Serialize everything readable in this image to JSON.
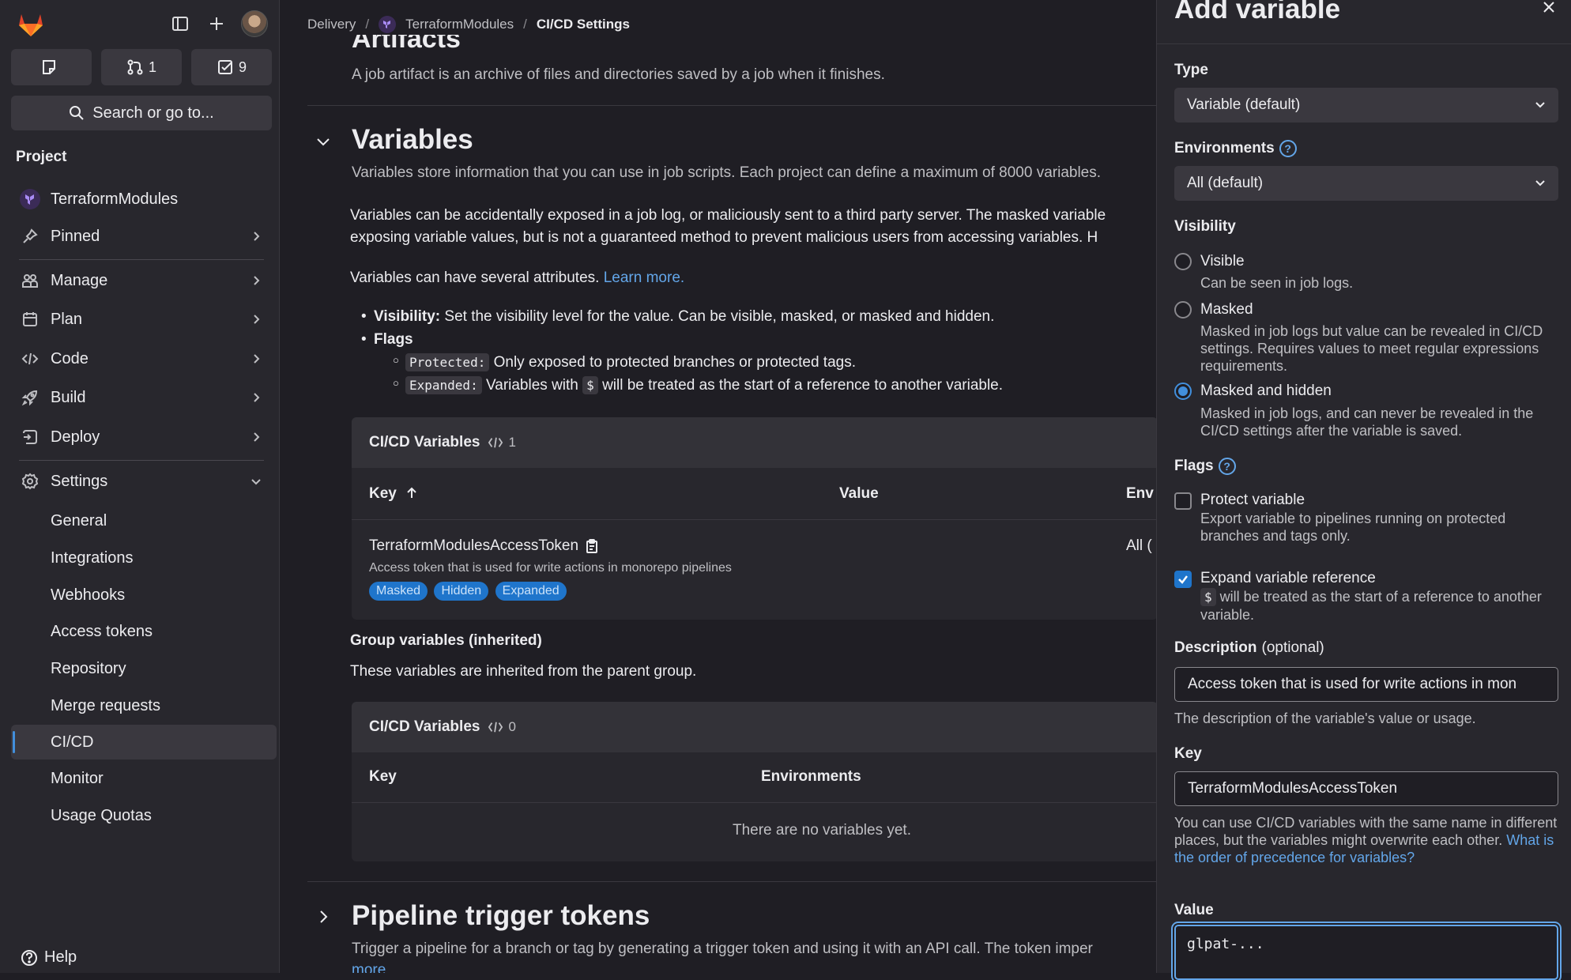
{
  "sidebar": {
    "counters": [
      {
        "icon": "issues-icon",
        "count": ""
      },
      {
        "icon": "merge-request-icon",
        "count": "1"
      },
      {
        "icon": "todo-icon",
        "count": "9"
      }
    ],
    "search_label": "Search or go to...",
    "heading": "Project",
    "project_name": "TerraformModules",
    "nav": {
      "pinned": "Pinned",
      "manage": "Manage",
      "plan": "Plan",
      "code": "Code",
      "build": "Build",
      "deploy": "Deploy",
      "settings": "Settings"
    },
    "settings_items": [
      "General",
      "Integrations",
      "Webhooks",
      "Access tokens",
      "Repository",
      "Merge requests",
      "CI/CD",
      "Monitor",
      "Usage Quotas"
    ],
    "help": "Help"
  },
  "breadcrumb": {
    "group": "Delivery",
    "project": "TerraformModules",
    "current": "CI/CD Settings"
  },
  "artifacts": {
    "title_partial": "Artifacts",
    "description": "A job artifact is an archive of files and directories saved by a job when it finishes."
  },
  "variables": {
    "title": "Variables",
    "intro": "Variables store information that you can use in job scripts. Each project can define a maximum of 8000 variables.",
    "warning_line1": "Variables can be accidentally exposed in a job log, or maliciously sent to a third party server. The masked variable",
    "warning_line2": "exposing variable values, but is not a guaranteed method to prevent malicious users from accessing variables. H",
    "attributes_text": "Variables can have several attributes.",
    "learn_more": "Learn more.",
    "bullet_visibility_bold": "Visibility:",
    "bullet_visibility_text": "Set the visibility level for the value. Can be visible, masked, or masked and hidden.",
    "bullet_flags": "Flags",
    "flag_protected_code": "Protected:",
    "flag_protected_text": "Only exposed to protected branches or protected tags.",
    "flag_expanded_code": "Expanded:",
    "flag_expanded_text_a": "Variables with",
    "flag_expanded_dollar": "$",
    "flag_expanded_text_b": "will be treated as the start of a reference to another variable."
  },
  "project_table": {
    "title": "CI/CD Variables",
    "count": "1",
    "col_key": "Key",
    "col_value": "Value",
    "col_env": "Env",
    "row": {
      "key": "TerraformModulesAccessToken",
      "description": "Access token that is used for write actions in monorepo pipelines",
      "env": "All (",
      "badges": [
        "Masked",
        "Hidden",
        "Expanded"
      ]
    }
  },
  "group_vars": {
    "title": "Group variables (inherited)",
    "description": "These variables are inherited from the parent group."
  },
  "group_table": {
    "title": "CI/CD Variables",
    "count": "0",
    "col_key": "Key",
    "col_env": "Environments",
    "empty": "There are no variables yet."
  },
  "pipeline_triggers": {
    "title": "Pipeline trigger tokens",
    "description": "Trigger a pipeline for a branch or tag by generating a trigger token and using it with an API call. The token imper",
    "more": "more"
  },
  "drawer": {
    "title": "Add variable",
    "type_label": "Type",
    "type_value": "Variable (default)",
    "env_label": "Environments",
    "env_value": "All (default)",
    "visibility_label": "Visibility",
    "visible_title": "Visible",
    "visible_help": "Can be seen in job logs.",
    "masked_title": "Masked",
    "masked_help": "Masked in job logs but value can be revealed in CI/CD settings. Requires values to meet regular expressions requirements.",
    "hidden_title": "Masked and hidden",
    "hidden_help": "Masked in job logs, and can never be revealed in the CI/CD settings after the variable is saved.",
    "selected_visibility": "Masked and hidden",
    "flags_label": "Flags",
    "protect_title": "Protect variable",
    "protect_help": "Export variable to pipelines running on protected branches and tags only.",
    "protect_checked": false,
    "expand_title": "Expand variable reference",
    "expand_dollar": "$",
    "expand_help": "will be treated as the start of a reference to another variable.",
    "expand_checked": true,
    "description_label": "Description",
    "description_optional": "(optional)",
    "description_value": "Access token that is used for write actions in mon",
    "description_help": "The description of the variable's value or usage.",
    "key_label": "Key",
    "key_value": "TerraformModulesAccessToken",
    "key_help": "You can use CI/CD variables with the same name in different places, but the variables might overwrite each other.",
    "key_help_link": "What is the order of precedence for variables?",
    "value_label": "Value",
    "value_value": "glpat-..."
  },
  "colors": {
    "background": "#1f1e24",
    "sidebar": "#28272d",
    "accent": "#428fdc",
    "link": "#63a6e9",
    "badge": "#1f75cb"
  }
}
